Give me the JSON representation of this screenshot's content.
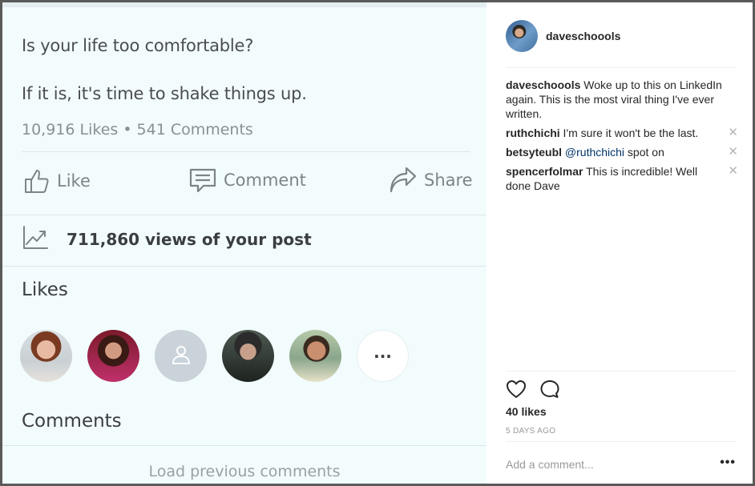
{
  "post_photo": {
    "line1": "Is your life too comfortable?",
    "line2": "If it is, it's time to shake things up.",
    "likes_stat": "10,916 Likes",
    "comments_stat": "541 Comments",
    "actions": {
      "like_label": "Like",
      "comment_label": "Comment",
      "share_label": "Share"
    },
    "views_text": "711,860 views of your post",
    "likes_heading": "Likes",
    "more_avatars_label": "···",
    "comments_heading": "Comments",
    "load_previous": "Load previous comments"
  },
  "panel": {
    "author": "daveschoools",
    "caption": {
      "user": "daveschoools",
      "text": " Woke up to this on LinkedIn again. This is the most viral thing I've ever written."
    },
    "comments": [
      {
        "user": "ruthchichi",
        "text": " I'm sure it won't be the last."
      },
      {
        "user": "betsyteubl",
        "mention": "@ruthchichi",
        "text": " spot on"
      },
      {
        "user": "spencerfolmar",
        "text": " This is incredible! Well done Dave"
      }
    ],
    "delete_glyph": "✕",
    "likes": "40 likes",
    "time_ago": "5 DAYS AGO",
    "add_comment_placeholder": "Add a comment...",
    "more_options": "•••"
  },
  "colors": {
    "photo_background": "#f2fcfd",
    "mention": "#003569",
    "text": "#262626",
    "muted": "#999999"
  }
}
